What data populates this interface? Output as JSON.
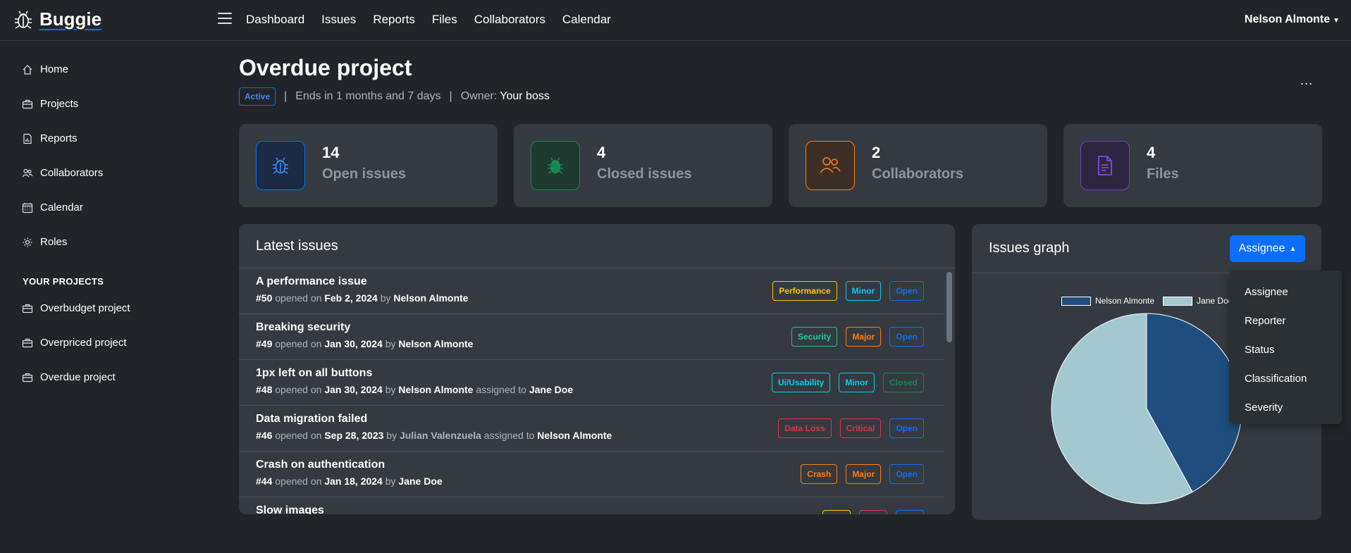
{
  "brand": "Buggie",
  "topnav": [
    "Dashboard",
    "Issues",
    "Reports",
    "Files",
    "Collaborators",
    "Calendar"
  ],
  "user": "Nelson Almonte",
  "sidebar": {
    "items": [
      "Home",
      "Projects",
      "Reports",
      "Collaborators",
      "Calendar",
      "Roles"
    ],
    "section_title": "YOUR PROJECTS",
    "projects": [
      "Overbudget project",
      "Overpriced project",
      "Overdue project"
    ]
  },
  "project": {
    "title": "Overdue project",
    "status": "Active",
    "ends": "Ends in 1 months and 7 days",
    "owner_label": "Owner:",
    "owner": "Your boss",
    "more": "..."
  },
  "stats": [
    {
      "value": "14",
      "label": "Open issues",
      "icon": "bug-icon",
      "color": "#0d6efd"
    },
    {
      "value": "4",
      "label": "Closed issues",
      "icon": "bug-fill-icon",
      "color": "#198754"
    },
    {
      "value": "2",
      "label": "Collaborators",
      "icon": "people-icon",
      "color": "#fd7e14"
    },
    {
      "value": "4",
      "label": "Files",
      "icon": "file-icon",
      "color": "#6f42c1"
    }
  ],
  "latest": {
    "title": "Latest issues",
    "issues": [
      {
        "title": "A performance issue",
        "num": "#50",
        "opened": "opened on",
        "date": "Feb 2, 2024",
        "by": "by",
        "author": "Nelson Almonte",
        "assigned_text": "",
        "assignee": "",
        "tags": [
          {
            "t": "Performance",
            "c": "#ffc107"
          },
          {
            "t": "Minor",
            "c": "#0dcaf0"
          },
          {
            "t": "Open",
            "c": "#0d6efd"
          }
        ]
      },
      {
        "title": "Breaking security",
        "num": "#49",
        "opened": "opened on",
        "date": "Jan 30, 2024",
        "by": "by",
        "author": "Nelson Almonte",
        "assigned_text": "",
        "assignee": "",
        "tags": [
          {
            "t": "Security",
            "c": "#20c997"
          },
          {
            "t": "Major",
            "c": "#fd7e14"
          },
          {
            "t": "Open",
            "c": "#0d6efd"
          }
        ]
      },
      {
        "title": "1px left on all buttons",
        "num": "#48",
        "opened": "opened on",
        "date": "Jan 30, 2024",
        "by": "by",
        "author": "Nelson Almonte",
        "assigned_text": "assigned to",
        "assignee": "Jane Doe",
        "tags": [
          {
            "t": "Ui/Usability",
            "c": "#0dcaf0"
          },
          {
            "t": "Minor",
            "c": "#0dcaf0"
          },
          {
            "t": "Closed",
            "c": "#198754"
          }
        ]
      },
      {
        "title": "Data migration failed",
        "num": "#46",
        "opened": "opened on",
        "date": "Sep 28, 2023",
        "by": "by",
        "author": "Julian Valenzuela",
        "assigned_text": "assigned to",
        "assignee": "Nelson Almonte",
        "tags": [
          {
            "t": "Data Loss",
            "c": "#dc3545"
          },
          {
            "t": "Critical",
            "c": "#dc3545"
          },
          {
            "t": "Open",
            "c": "#0d6efd"
          }
        ]
      },
      {
        "title": "Crash on authentication",
        "num": "#44",
        "opened": "opened on",
        "date": "Jan 18, 2024",
        "by": "by",
        "author": "Jane Doe",
        "assigned_text": "",
        "assignee": "",
        "tags": [
          {
            "t": "Crash",
            "c": "#fd7e14"
          },
          {
            "t": "Major",
            "c": "#fd7e14"
          },
          {
            "t": "Open",
            "c": "#0d6efd"
          }
        ]
      },
      {
        "title": "Slow images",
        "num": "",
        "opened": "",
        "date": "",
        "by": "",
        "author": "",
        "assigned_text": "",
        "assignee": "",
        "tags": [
          {
            "t": "",
            "c": "#ffc107"
          },
          {
            "t": "",
            "c": "#dc3545"
          },
          {
            "t": "",
            "c": "#0d6efd"
          }
        ]
      }
    ]
  },
  "graph": {
    "title": "Issues graph",
    "button": "Assignee",
    "dropdown": [
      "Assignee",
      "Reporter",
      "Status",
      "Classification",
      "Severity"
    ]
  },
  "chart_data": {
    "type": "pie",
    "categories": [
      "Nelson Almonte",
      "Jane Doe"
    ],
    "values": [
      42,
      58
    ],
    "colors": [
      "#1f4e7e",
      "#a3c8cf"
    ]
  }
}
